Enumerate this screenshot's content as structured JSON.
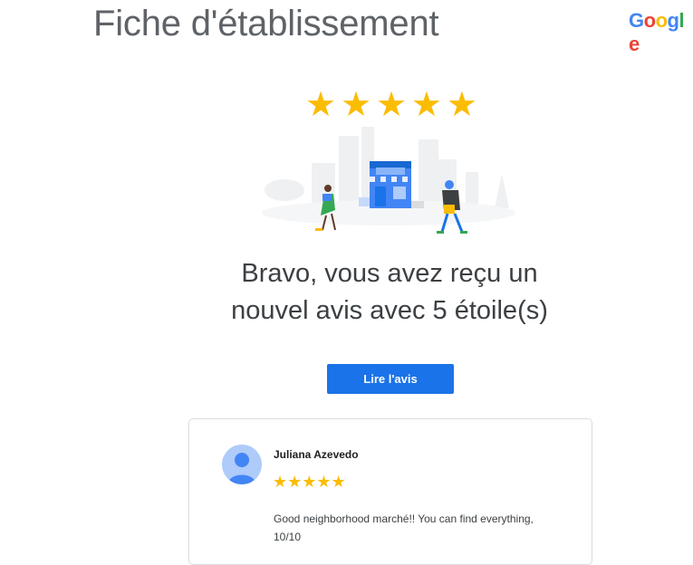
{
  "header": {
    "title": "Fiche d'établissement",
    "logo_letters": [
      {
        "char": "G",
        "color": "#4285f4"
      },
      {
        "char": "o",
        "color": "#ea4335"
      },
      {
        "char": "o",
        "color": "#fbbc05"
      },
      {
        "char": "g",
        "color": "#4285f4"
      },
      {
        "char": "l",
        "color": "#34a853"
      },
      {
        "char": "e",
        "color": "#ea4335"
      }
    ]
  },
  "hero": {
    "rating_stars": 5,
    "star_glyph": "★",
    "headline_line1": "Bravo, vous avez reçu un",
    "headline_line2": "nouvel avis avec 5 étoile(s)",
    "cta_label": "Lire l'avis"
  },
  "review": {
    "reviewer_name": "Juliana Azevedo",
    "stars": "★★★★★",
    "text_line1": "Good neighborhood marché!! You can find everything,",
    "text_line2": "10/10"
  },
  "colors": {
    "accent": "#1a73e8",
    "star": "#fbbc04",
    "avatar_bg": "#aecbfa",
    "avatar_fg": "#4285f4"
  }
}
